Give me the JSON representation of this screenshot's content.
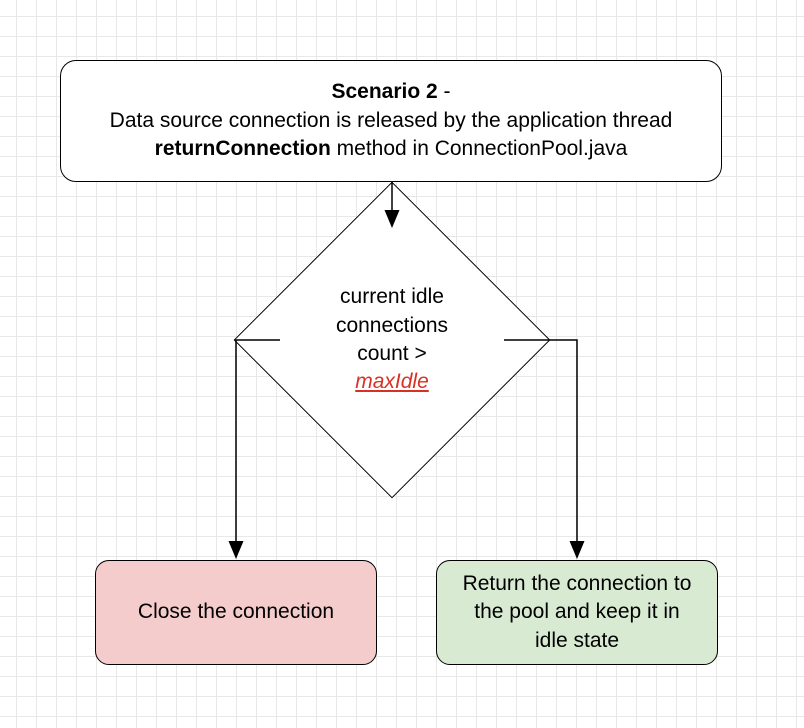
{
  "header": {
    "title_prefix": "Scenario 2",
    "title_dash": " - ",
    "line1": "Data source connection is released by the application thread",
    "method": "returnConnection",
    "line2_suffix": " method in ConnectionPool.java"
  },
  "decision": {
    "line1": "current idle",
    "line2": "connections count > ",
    "emphasis": "maxIdle"
  },
  "outcomes": {
    "left": "Close the connection",
    "right": "Return the connection to the pool and keep it in idle state"
  },
  "chart_data": {
    "type": "flowchart",
    "nodes": [
      {
        "id": "start",
        "shape": "rounded-rect",
        "text": "Scenario 2 - Data source connection is released by the application thread returnConnection method in ConnectionPool.java"
      },
      {
        "id": "decision",
        "shape": "diamond",
        "text": "current idle connections count > maxIdle"
      },
      {
        "id": "close",
        "shape": "rounded-rect",
        "fill": "#f4cccc",
        "text": "Close the connection"
      },
      {
        "id": "return",
        "shape": "rounded-rect",
        "fill": "#d9ead3",
        "text": "Return the connection to the pool and keep it in idle state"
      }
    ],
    "edges": [
      {
        "from": "start",
        "to": "decision"
      },
      {
        "from": "decision",
        "to": "close"
      },
      {
        "from": "decision",
        "to": "return"
      }
    ]
  }
}
